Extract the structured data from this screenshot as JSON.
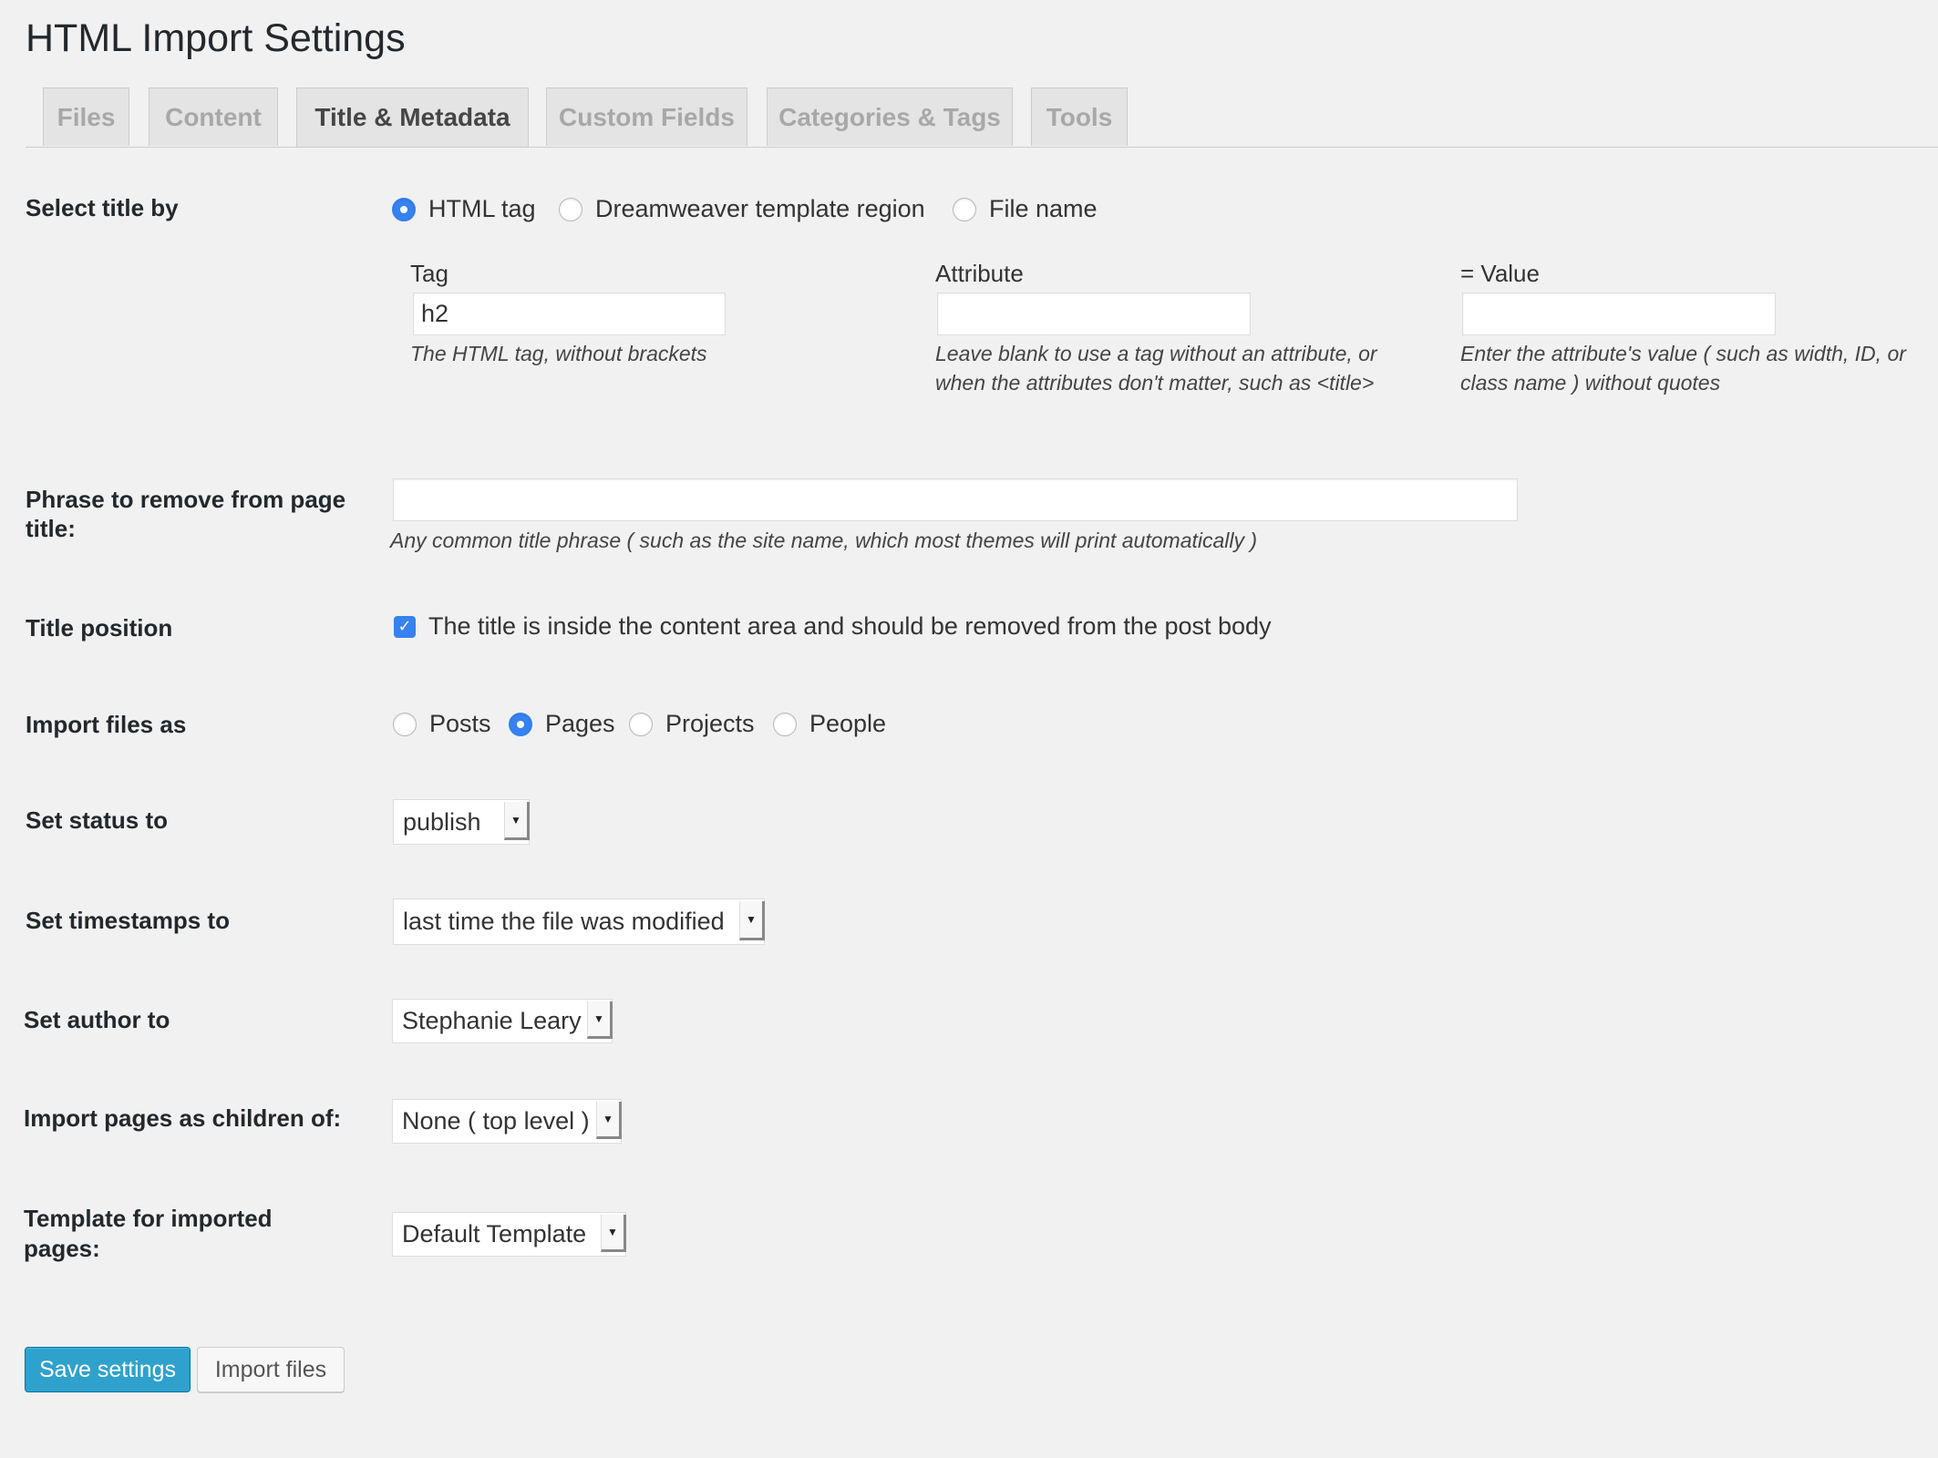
{
  "page": {
    "title": "HTML Import Settings"
  },
  "tabs": [
    {
      "label": "Files",
      "active": false
    },
    {
      "label": "Content",
      "active": false
    },
    {
      "label": "Title & Metadata",
      "active": true
    },
    {
      "label": "Custom Fields",
      "active": false
    },
    {
      "label": "Categories & Tags",
      "active": false
    },
    {
      "label": "Tools",
      "active": false
    }
  ],
  "select_title_by": {
    "label": "Select title by",
    "options": [
      {
        "label": "HTML tag",
        "selected": true
      },
      {
        "label": "Dreamweaver template region",
        "selected": false
      },
      {
        "label": "File name",
        "selected": false
      }
    ],
    "tag": {
      "label": "Tag",
      "value": "h2",
      "help": "The HTML tag, without brackets"
    },
    "attribute": {
      "label": "Attribute",
      "value": "",
      "help_line1": "Leave blank to use a tag without an attribute, or",
      "help_line2": "when the attributes don't matter, such as <title>"
    },
    "value": {
      "label": "= Value",
      "value": "",
      "help_line1": "Enter the attribute's value ( such as width, ID, or",
      "help_line2": "class name ) without quotes"
    }
  },
  "phrase_remove": {
    "label_line1": "Phrase to remove from page",
    "label_line2": "title:",
    "value": "",
    "help": "Any common title phrase ( such as the site name, which most themes will print automatically )"
  },
  "title_position": {
    "label": "Title position",
    "checkbox_label": "The title is inside the content area and should be removed from the post body",
    "checked": true
  },
  "import_as": {
    "label": "Import files as",
    "options": [
      {
        "label": "Posts",
        "selected": false
      },
      {
        "label": "Pages",
        "selected": true
      },
      {
        "label": "Projects",
        "selected": false
      },
      {
        "label": "People",
        "selected": false
      }
    ]
  },
  "status": {
    "label": "Set status to",
    "value": "publish"
  },
  "timestamps": {
    "label": "Set timestamps to",
    "value": "last time the file was modified"
  },
  "author": {
    "label": "Set author to",
    "value": "Stephanie Leary"
  },
  "parent": {
    "label": "Import pages as children of:",
    "value": "None ( top level )"
  },
  "template": {
    "label_line1": "Template for imported",
    "label_line2": "pages:",
    "value": "Default Template"
  },
  "buttons": {
    "save": "Save settings",
    "import": "Import files"
  },
  "colors": {
    "accent": "#3582f0",
    "primary_button": "#2ea2cc",
    "background": "#f1f1f1"
  }
}
